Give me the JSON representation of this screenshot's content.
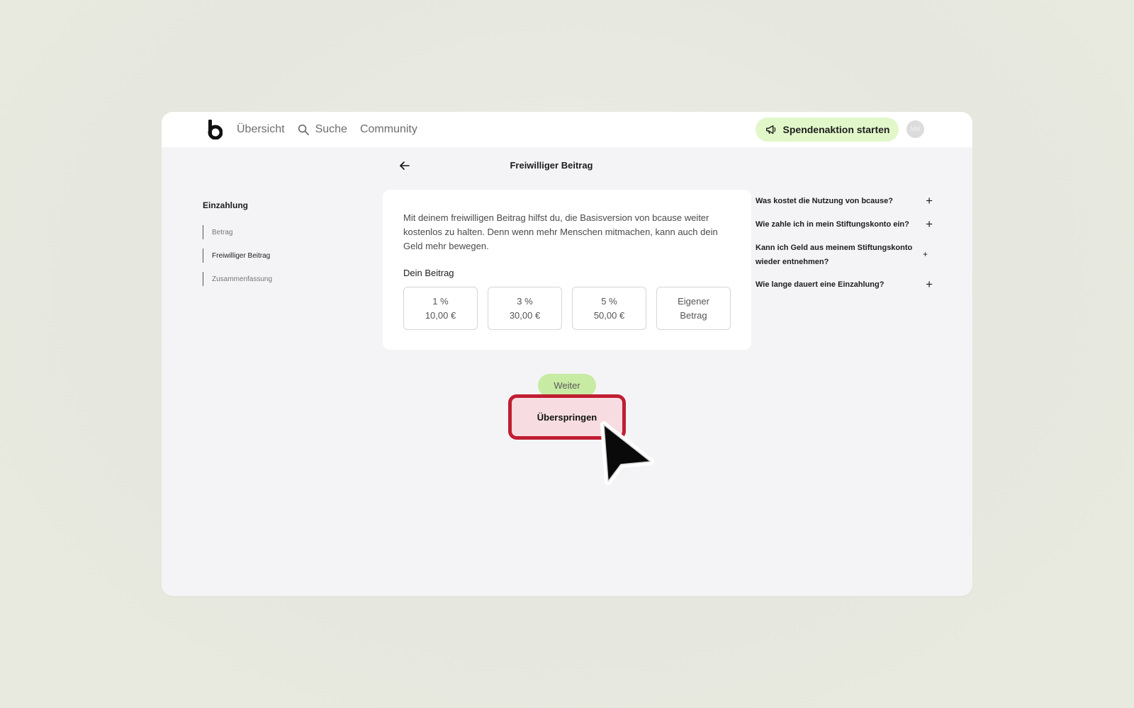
{
  "nav": {
    "items": [
      {
        "label": "Übersicht",
        "icon": ""
      },
      {
        "label": "Suche",
        "icon": "search-icon"
      },
      {
        "label": "Community",
        "icon": ""
      }
    ],
    "cta_label": "Spendenaktion starten",
    "cta_icon": "megaphone-icon",
    "avatar_initials": "MM"
  },
  "page": {
    "title": "Freiwilliger Beitrag"
  },
  "sidebar": {
    "title": "Einzahlung",
    "steps": [
      {
        "label": "Betrag",
        "active": false
      },
      {
        "label": "Freiwilliger Beitrag",
        "active": true
      },
      {
        "label": "Zusammenfassung",
        "active": false
      }
    ]
  },
  "card": {
    "text": "Mit deinem freiwilligen Beitrag hilfst du, die Basisversion von bcause weiter kostenlos zu halten. Denn wenn mehr Menschen mitmachen, kann auch dein Geld mehr bewegen.",
    "label": "Dein Beitrag",
    "options": [
      {
        "line1": "1 %",
        "line2": "10,00 €"
      },
      {
        "line1": "3 %",
        "line2": "30,00 €"
      },
      {
        "line1": "5 %",
        "line2": "50,00 €"
      },
      {
        "line1": "Eigener",
        "line2": "Betrag"
      }
    ]
  },
  "faq": [
    {
      "question": "Was kostet die Nutzung von bcause?"
    },
    {
      "question": "Wie zahle ich in mein Stiftungskonto ein?"
    },
    {
      "question": "Kann ich Geld aus meinem Stiftungskonto wieder entnehmen?"
    },
    {
      "question": "Wie lange dauert eine Einzahlung?"
    }
  ],
  "actions": {
    "next_label": "Weiter",
    "skip_label": "Überspringen"
  },
  "colors": {
    "accent_green": "#c8eba4",
    "cta_green": "#e2f7c9",
    "highlight_red": "#c01e32",
    "highlight_fill": "#f7dde1"
  }
}
